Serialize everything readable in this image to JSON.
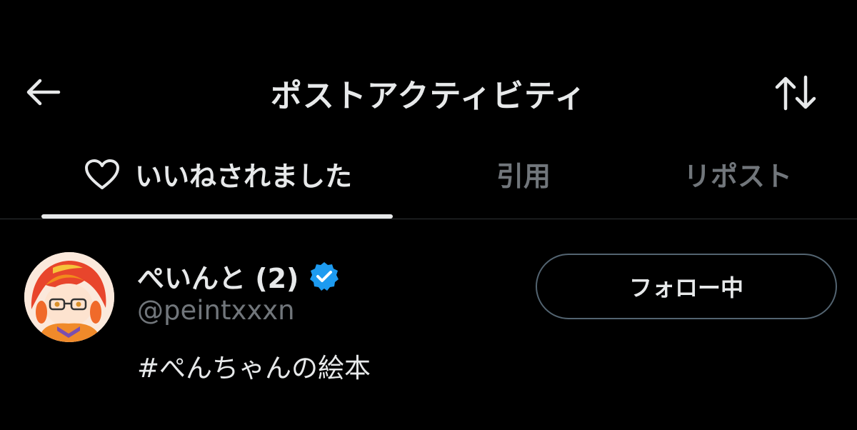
{
  "header": {
    "title": "ポストアクティビティ",
    "back_icon": "arrow-left-icon",
    "sort_icon": "sort-arrows-icon"
  },
  "tabs": [
    {
      "label": "いいねされました",
      "icon": "heart-icon",
      "active": true
    },
    {
      "label": "引用",
      "active": false
    },
    {
      "label": "リポスト",
      "active": false
    }
  ],
  "user": {
    "display_name": "ぺいんと (2)",
    "verified": true,
    "handle": "@peintxxxn",
    "bio": "#ぺんちゃんの絵本",
    "follow_label": "フォロー中"
  },
  "colors": {
    "background": "#000000",
    "text_primary": "#e7e9ea",
    "text_secondary": "#71767b",
    "verified_blue": "#1d9bf0",
    "border": "#536471"
  }
}
